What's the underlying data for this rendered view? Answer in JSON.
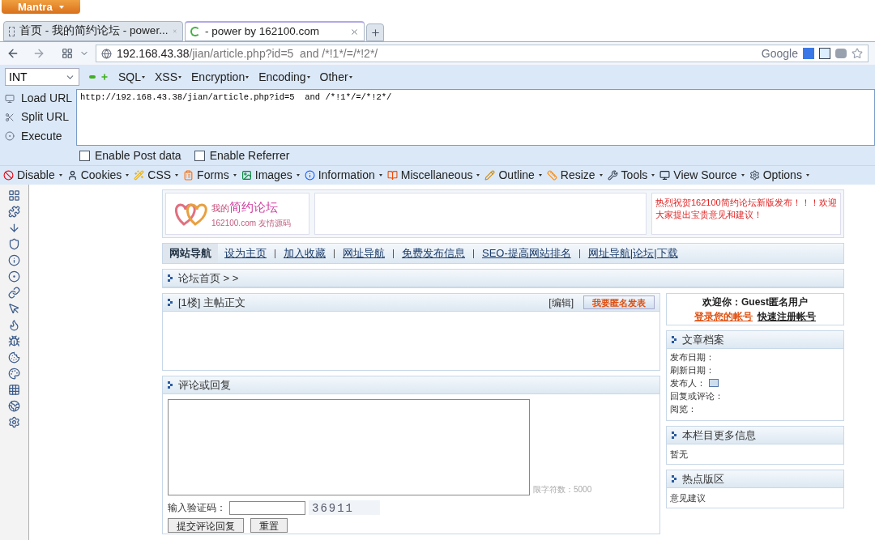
{
  "mantra_button": {
    "label": "Mantra"
  },
  "tabs": [
    {
      "label": "首页 - 我的简约论坛 - power...",
      "selected": false,
      "loading": false
    },
    {
      "label": "- power by 162100.com",
      "selected": true,
      "loading": true
    }
  ],
  "address_bar": {
    "host": "192.168.43.38",
    "path": "/jian/article.php?id=5  and /*!1*/=/*!2*/",
    "search_engine": "Google"
  },
  "hackbar": {
    "type_select": "INT",
    "menus": [
      "SQL",
      "XSS",
      "Encryption",
      "Encoding",
      "Other"
    ],
    "actions": [
      "Load URL",
      "Split URL",
      "Execute"
    ],
    "url_value": "http://192.168.43.38/jian/article.php?id=5  and /*!1*/=/*!2*/",
    "checkboxes": [
      {
        "label": "Enable Post data",
        "checked": false
      },
      {
        "label": "Enable Referrer",
        "checked": false
      }
    ]
  },
  "webdev_toolbar": [
    "Disable",
    "Cookies",
    "CSS",
    "Forms",
    "Images",
    "Information",
    "Miscellaneous",
    "Outline",
    "Resize",
    "Tools",
    "View Source",
    "Options"
  ],
  "page": {
    "logo": {
      "prefix": "我的",
      "name": "简约论坛",
      "subtitle": "162100.com 友情源码"
    },
    "notice": "热烈祝贺162100简约论坛新版发布！！！欢迎大家提出宝贵意见和建议！",
    "nav": {
      "label": "网站导航",
      "links": [
        "设为主页",
        "加入收藏",
        "网址导航",
        "免费发布信息",
        "SEO-提高网站排名",
        "网址导航|论坛|下载"
      ]
    },
    "breadcrumb": "论坛首页 > >",
    "post": {
      "title": "[1楼] 主帖正文",
      "edit": "[编辑]",
      "anonymous_post": "我要匿名发表"
    },
    "reply": {
      "title": "评论或回复",
      "limit": "限字符数：5000",
      "captcha_label": "输入验证码：",
      "captcha_code": "36911",
      "buttons": [
        "提交评论回复",
        "重置"
      ]
    },
    "sidebar": {
      "welcome": "欢迎你：Guest匿名用户",
      "login": "登录您的帐号",
      "register": "快速注册帐号",
      "archive": {
        "title": "文章档案",
        "fields": [
          "发布日期：",
          "刷新日期：",
          "发布人：",
          "回复或评论：",
          "阅览："
        ]
      },
      "more": {
        "title": "本栏目更多信息",
        "text": "暂无"
      },
      "hot": {
        "title": "热点版区",
        "text": "意见建议"
      }
    }
  }
}
